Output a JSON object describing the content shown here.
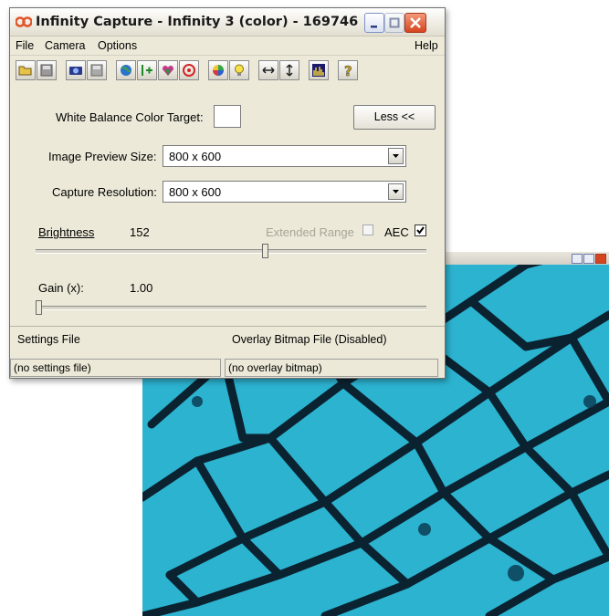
{
  "window": {
    "title": "Infinity Capture - Infinity 3 (color) - 169746"
  },
  "menu": {
    "file": "File",
    "camera": "Camera",
    "options": "Options",
    "help": "Help"
  },
  "toolbar": {
    "icons": [
      "open-folder-icon",
      "save-icon",
      "camera-icon",
      "save-disabled-icon",
      "globe-icon",
      "crosshair-icon",
      "color-heart-icon",
      "target-icon",
      "color-wheel-icon",
      "lightbulb-icon",
      "horizontal-arrows-icon",
      "vertical-arrows-icon",
      "histogram-icon",
      "help-icon"
    ]
  },
  "white_balance": {
    "label": "White Balance Color Target:",
    "less_button": "Less <<"
  },
  "image_preview": {
    "label": "Image Preview Size:",
    "value": "800 x 600"
  },
  "capture_resolution": {
    "label": "Capture Resolution:",
    "value": "800 x 600"
  },
  "brightness": {
    "label": "Brightness",
    "value": "152",
    "extended_range_label": "Extended Range",
    "extended_range_checked": false,
    "aec_label": "AEC",
    "aec_checked": true,
    "slider_fraction": 0.59
  },
  "gain": {
    "label": "Gain (x):",
    "value": "1.00",
    "slider_fraction": 0.0
  },
  "settings_file": {
    "label": "Settings File",
    "value": "(no settings file)"
  },
  "overlay_file": {
    "label": "Overlay Bitmap File (Disabled)",
    "value": "(no overlay bitmap)"
  },
  "colors": {
    "preview_bg": "#2bb3d0",
    "cell_wall": "#0b2230",
    "window_face": "#ece9d8",
    "close_red": "#d5451f"
  }
}
